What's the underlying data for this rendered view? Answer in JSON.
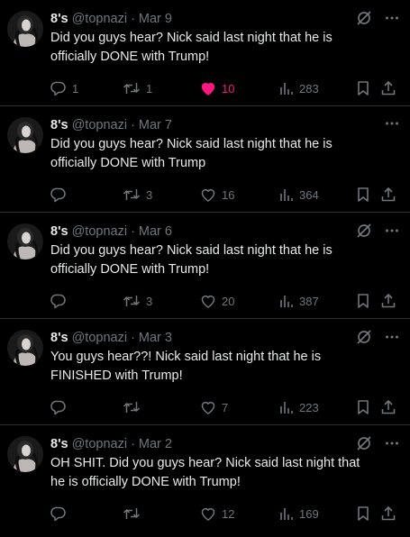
{
  "colors": {
    "background": "#000000",
    "text": "#e7e9ea",
    "muted": "#71767b",
    "like_active": "#f91880",
    "divider": "#2f3336"
  },
  "icons": {
    "reply": "reply-icon",
    "retweet": "retweet-icon",
    "like": "heart-icon",
    "views": "views-icon",
    "bookmark": "bookmark-icon",
    "share": "share-icon",
    "grok": "grok-icon",
    "more": "more-icon"
  },
  "tweets": [
    {
      "name": "8's",
      "handle": "@topnazi",
      "date": "Mar 9",
      "text": "Did you guys hear? Nick said last night that he is officially DONE with Trump!",
      "replies": "1",
      "retweets": "1",
      "likes": "10",
      "views": "283",
      "liked": true
    },
    {
      "name": "8's",
      "handle": "@topnazi",
      "date": "Mar 7",
      "text": "Did you guys hear? Nick said last night that he is officially DONE with Trump",
      "replies": "",
      "retweets": "3",
      "likes": "16",
      "views": "364",
      "liked": false
    },
    {
      "name": "8's",
      "handle": "@topnazi",
      "date": "Mar 6",
      "text": "Did you guys hear? Nick said last night that he is officially DONE with Trump!",
      "replies": "",
      "retweets": "3",
      "likes": "20",
      "views": "387",
      "liked": false
    },
    {
      "name": "8's",
      "handle": "@topnazi",
      "date": "Mar 3",
      "text": "You guys hear??! Nick said last night that he is FINISHED with Trump!",
      "replies": "",
      "retweets": "",
      "likes": "7",
      "views": "223",
      "liked": false
    },
    {
      "name": "8's",
      "handle": "@topnazi",
      "date": "Mar 2",
      "text": "OH SHIT. Did you guys hear? Nick said last night that he is officially DONE with Trump!",
      "replies": "",
      "retweets": "",
      "likes": "12",
      "views": "169",
      "liked": false
    }
  ]
}
